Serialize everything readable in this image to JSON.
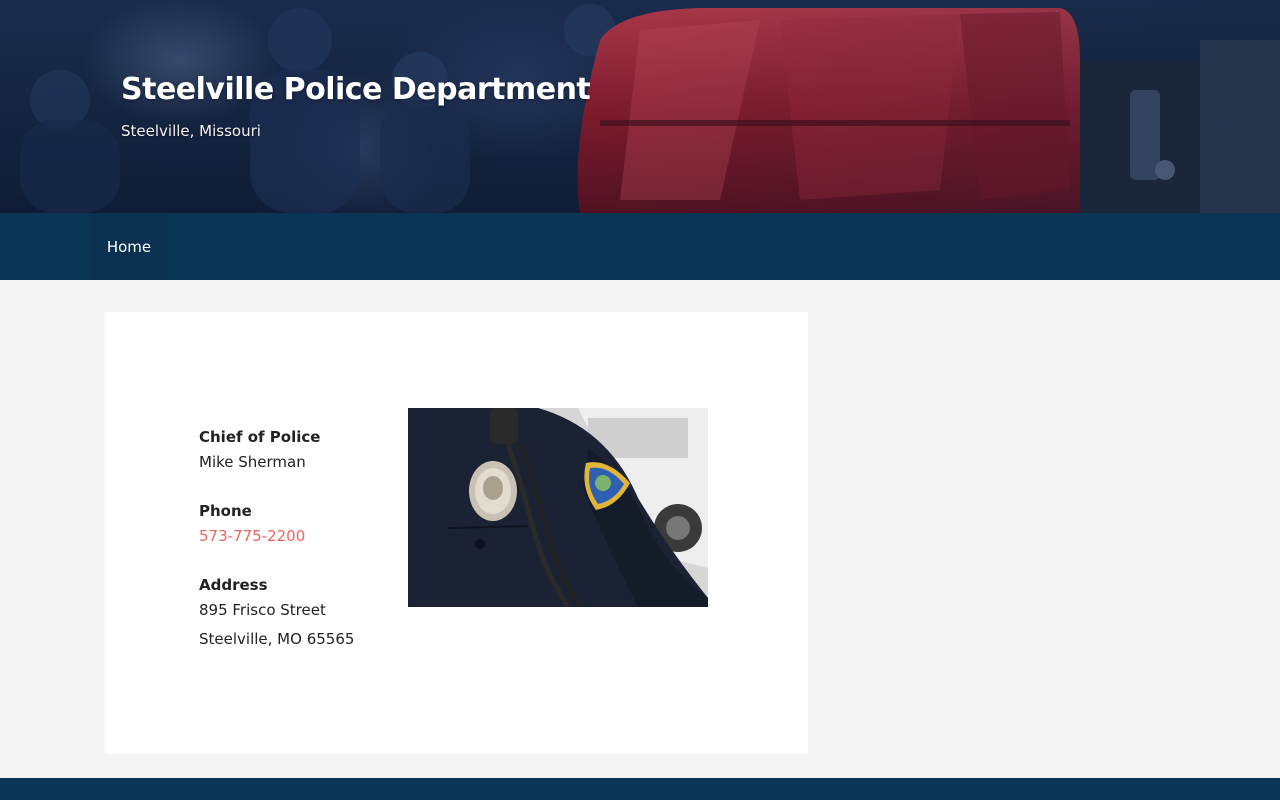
{
  "header": {
    "title": "Steelville Police Department",
    "tagline": "Steelville, Missouri"
  },
  "nav": {
    "items": [
      {
        "label": "Home"
      }
    ]
  },
  "contact": {
    "chief_label": "Chief of Police",
    "chief_name": "Mike Sherman",
    "phone_label": "Phone",
    "phone_number": "573-775-2200",
    "address_label": "Address",
    "address_line1": "895 Frisco Street",
    "address_line2": "Steelville, MO 65565"
  },
  "colors": {
    "nav_bg": "#0b3554",
    "link": "#e8665c",
    "page_bg": "#f4f4f4"
  }
}
